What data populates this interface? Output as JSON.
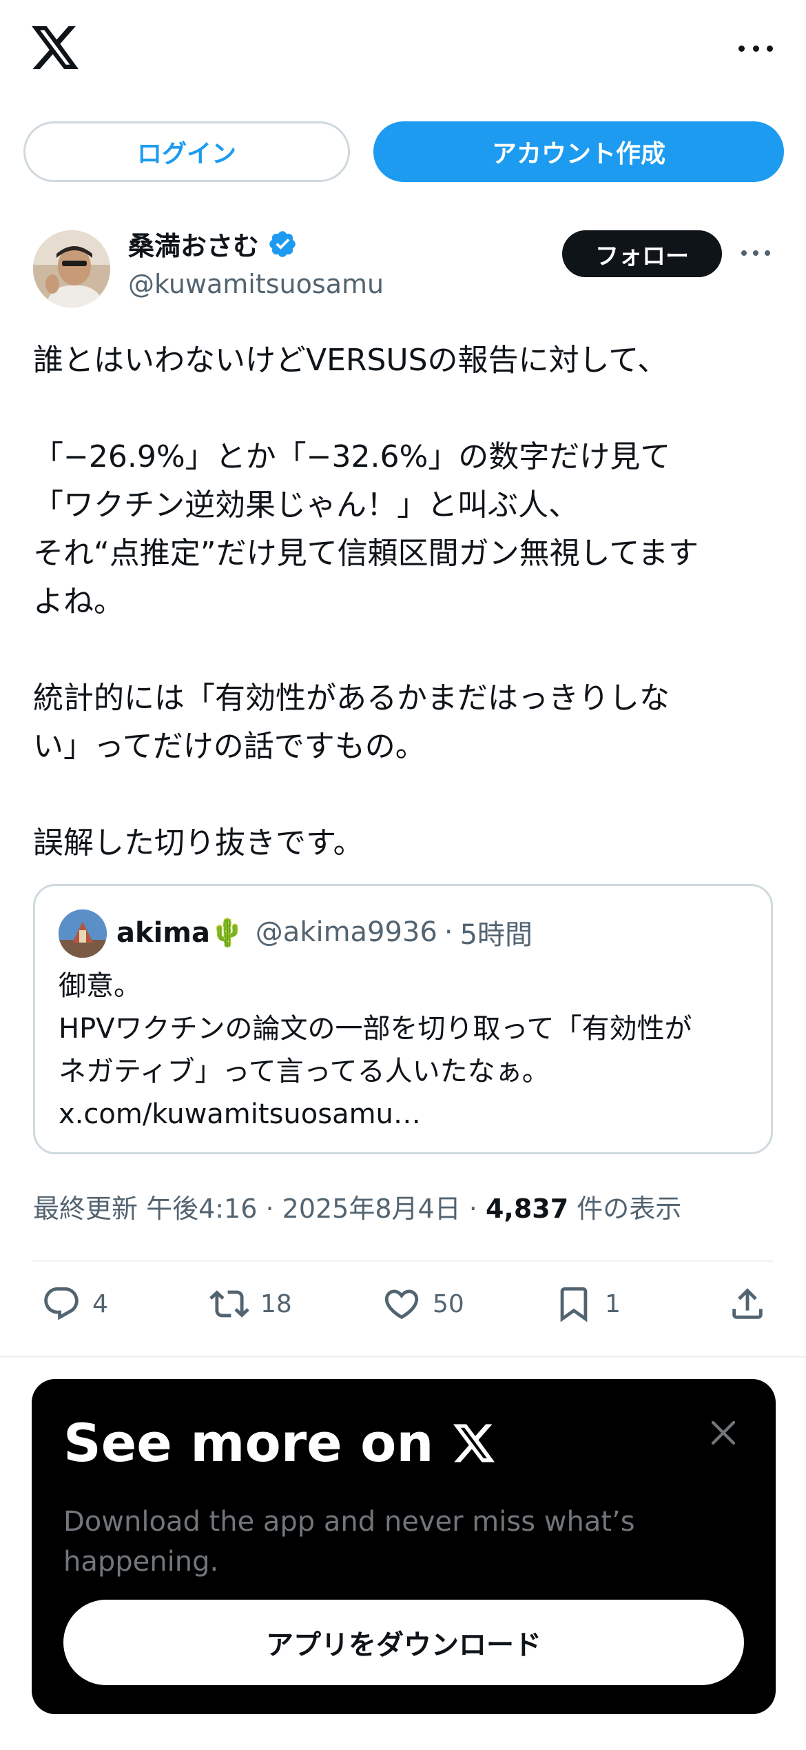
{
  "header": {
    "logo_icon": "x-logo-icon",
    "more_icon": "more-horizontal-icon"
  },
  "auth": {
    "login_label": "ログイン",
    "signup_label": "アカウント作成"
  },
  "tweet": {
    "author": {
      "name": "桑満おさむ",
      "handle": "@kuwamitsuosamu",
      "verified": true
    },
    "follow_label": "フォロー",
    "paragraphs": [
      "誰とはいわないけどVERSUSの報告に対して、",
      "「−26.9%」とか「−32.6%」の数字だけ見て\n「ワクチン逆効果じゃん！」と叫ぶ人、\nそれ“点推定”だけ見て信頼区間ガン無視してます\nよね。",
      "統計的には「有効性があるかまだはっきりしな\nい」ってだけの話ですもの。",
      "誤解した切り抜きです。"
    ],
    "quote": {
      "name": "akima🌵",
      "handle": "@akima9936",
      "separator": "·",
      "time": "5時間",
      "lines": [
        "御意。",
        "HPVワクチンの論文の一部を切り取って「有効性が",
        "ネガティブ」って言ってる人いたなぁ。",
        "x.com/kuwamitsuosamu…"
      ]
    },
    "meta": {
      "prefix": "最終更新 午後4:16 · 2025年8月4日 · ",
      "views_count": "4,837",
      "views_label": " 件の表示"
    },
    "actions": {
      "replies": "4",
      "retweets": "18",
      "likes": "50",
      "bookmarks": "1"
    }
  },
  "promo": {
    "title": "See more on",
    "subtitle": "Download the app and never miss what’s happening.",
    "button_label": "アプリをダウンロード"
  },
  "colors": {
    "brand_blue": "#1d9bf0",
    "text_primary": "#0f1419",
    "text_secondary": "#536471",
    "border": "#cfd9de"
  }
}
